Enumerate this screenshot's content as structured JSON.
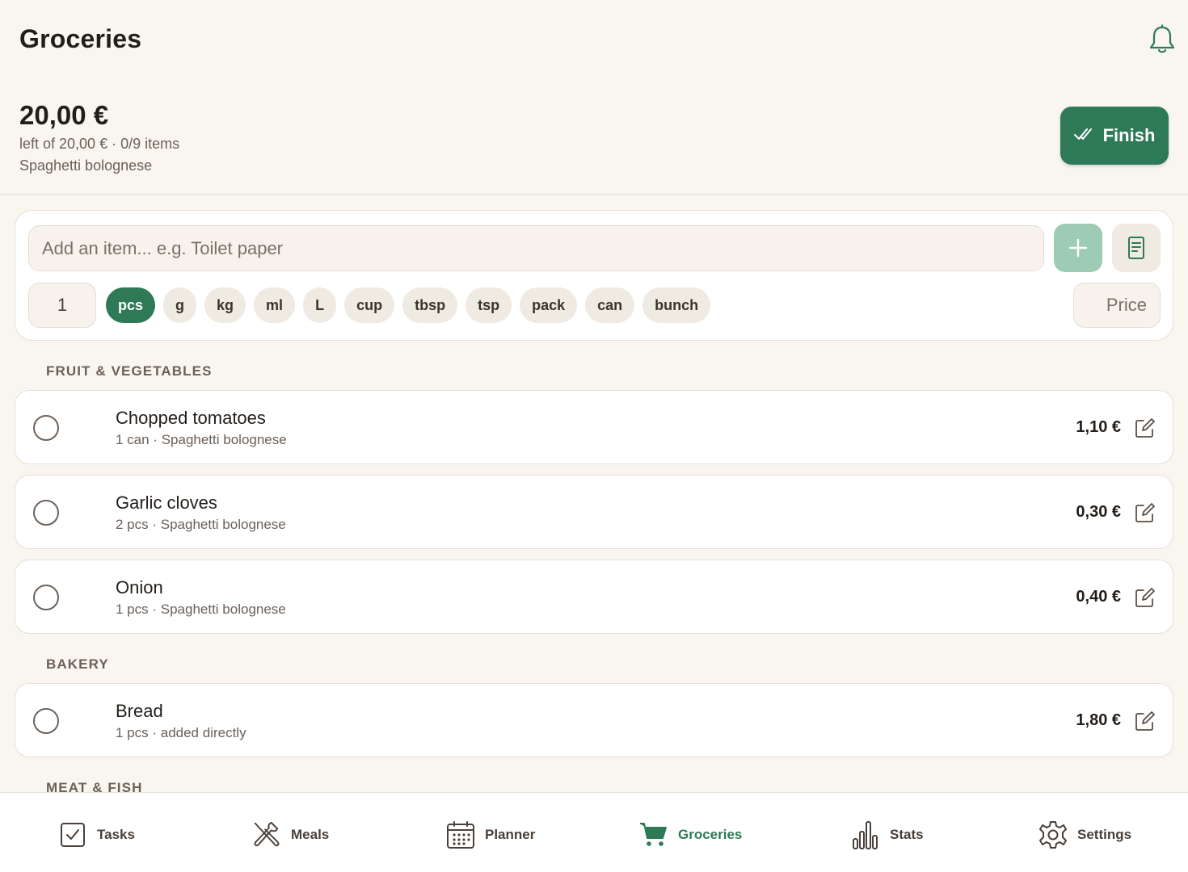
{
  "app": {
    "title": "Groceries"
  },
  "colors": {
    "accent": "#2e7a57",
    "accent_light": "#9dcbb3",
    "background": "#f9f6f0",
    "chip": "#f0ebe2"
  },
  "summary": {
    "remaining": "20,00 €",
    "subtitle": "left of 20,00 € · 0/9 items",
    "recipe": "Spaghetti bolognese",
    "finish_label": "Finish"
  },
  "add_item": {
    "placeholder": "Add an item... e.g. Toilet paper",
    "quantity": "1",
    "price_placeholder": "Price",
    "units": [
      "pcs",
      "g",
      "kg",
      "ml",
      "L",
      "cup",
      "tbsp",
      "tsp",
      "pack",
      "can",
      "bunch"
    ],
    "selected_unit": "pcs"
  },
  "sections": [
    {
      "label": "FRUIT & VEGETABLES",
      "items": [
        {
          "name": "Chopped tomatoes",
          "meta": "1 can · Spaghetti bolognese",
          "price": "1,10 €",
          "checked": false
        },
        {
          "name": "Garlic cloves",
          "meta": "2 pcs · Spaghetti bolognese",
          "price": "0,30 €",
          "checked": false
        },
        {
          "name": "Onion",
          "meta": "1 pcs · Spaghetti bolognese",
          "price": "0,40 €",
          "checked": false
        }
      ]
    },
    {
      "label": "BAKERY",
      "items": [
        {
          "name": "Bread",
          "meta": "1 pcs · added directly",
          "price": "1,80 €",
          "checked": false
        }
      ]
    },
    {
      "label": "MEAT & FISH",
      "items": []
    }
  ],
  "nav": {
    "tasks": "Tasks",
    "meals": "Meals",
    "planner": "Planner",
    "groceries": "Groceries",
    "stats": "Stats",
    "settings": "Settings",
    "active": "groceries"
  },
  "icons": {
    "bell": "bell-icon",
    "finish": "double-check-icon",
    "plus": "plus-icon",
    "list": "receipt-icon",
    "edit": "edit-icon",
    "tasks": "checkbox-icon",
    "meals": "utensils-icon",
    "planner": "calendar-icon",
    "groceries": "cart-icon",
    "stats": "bar-chart-icon",
    "settings": "gear-icon"
  }
}
